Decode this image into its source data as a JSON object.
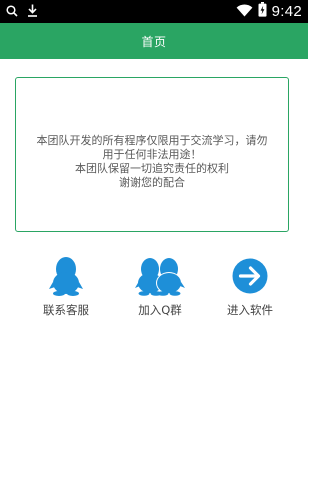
{
  "status_bar": {
    "time": "9:42",
    "left_icons": [
      "search-icon",
      "download-icon"
    ],
    "right_icons": [
      "wifi-icon",
      "battery-icon"
    ]
  },
  "app_bar": {
    "title": "首页",
    "color": "#2aa563"
  },
  "notice": {
    "lines": [
      "本团队开发的所有程序仅限用于交流学习，请勿",
      "用于任何非法用途！",
      "本团队保留一切追究责任的权利",
      "谢谢您的配合"
    ],
    "border_color": "#2aa563"
  },
  "actions": [
    {
      "label": "联系客服",
      "icon": "qq-penguin-icon",
      "color": "#1e8fd8"
    },
    {
      "label": "加入Q群",
      "icon": "qq-group-icon",
      "color": "#1e8fd8"
    },
    {
      "label": "进入软件",
      "icon": "arrow-right-circle-icon",
      "color": "#1e8fd8"
    }
  ]
}
